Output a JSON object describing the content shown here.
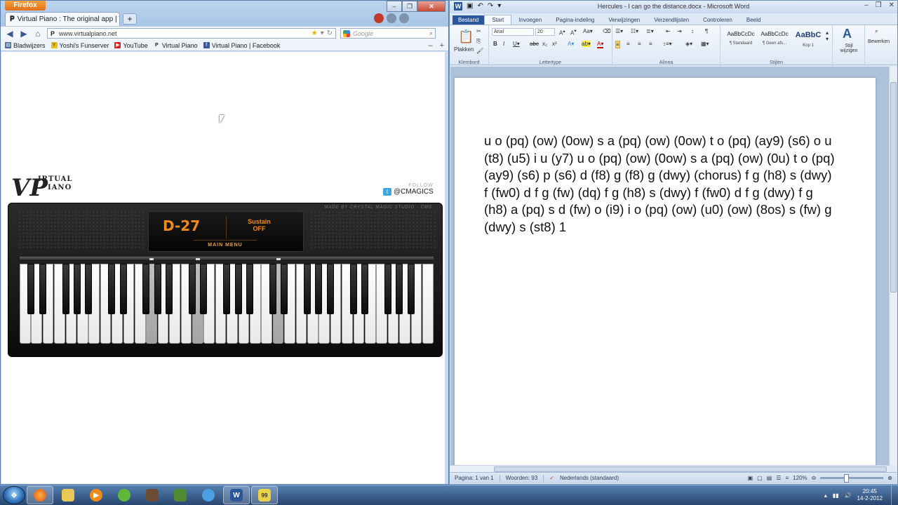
{
  "firefox": {
    "menu_label": "Firefox",
    "tab_title": "Virtual Piano : The original app | Virtual ...",
    "url": "www.virtualpiano.net",
    "search_placeholder": "Google",
    "bookmarks": [
      {
        "label": "Bladwijzers",
        "icon": "bookmarks-icon"
      },
      {
        "label": "Yoshi's Funserver",
        "icon": "yfs-icon"
      },
      {
        "label": "YouTube",
        "icon": "youtube-icon"
      },
      {
        "label": "Virtual Piano",
        "icon": "vp-icon"
      },
      {
        "label": "Virtual Piano | Facebook",
        "icon": "facebook-icon"
      }
    ]
  },
  "piano_page": {
    "logo_text": "IRTUAL",
    "logo_text2": "IANO",
    "follow_label": "FOLLOW",
    "twitter_handle": "@CMAGICS",
    "maker": "MADE BY CRYSTAL MAGIC STUDIO - CMS",
    "note_display": "D-27",
    "sustain_label": "Sustain",
    "sustain_state": "OFF",
    "main_menu": "MAIN MENU",
    "pressed_white_keys": [
      11,
      15,
      22
    ]
  },
  "word": {
    "title": "Hercules - I can go the distance.docx - Microsoft Word",
    "tabs": [
      "Bestand",
      "Start",
      "Invoegen",
      "Pagina-indeling",
      "Verwijzingen",
      "Verzendlijsten",
      "Controleren",
      "Beeld"
    ],
    "groups": {
      "clipboard": "Klembord",
      "paste": "Plakken",
      "font": "Lettertype",
      "font_name": "Arial",
      "font_size": "20",
      "paragraph": "Alinea",
      "styles": "Stijlen",
      "style_samples": [
        {
          "preview": "AaBbCcDc",
          "name": "¶ Standaard"
        },
        {
          "preview": "AaBbCcDc",
          "name": "¶ Geen afs..."
        },
        {
          "preview": "AaBbC",
          "name": "Kop 1"
        }
      ],
      "change_styles": "Stijl wijzigen",
      "editing": "Bewerken"
    },
    "document_text": "u o (pq) (ow) (0ow) s a (pq) (ow) (0ow) t o (pq) (ay9) (s6) o u (t8) (u5) i u (y7) u o (pq) (ow) (0ow) s a (pq) (ow) (0u) t o (pq) (ay9) (s6) p (s6) d (f8) g (f8) g (dwy) (chorus) f g (h8) s (dwy) f (fw0) d f g (fw) (dq) f g (h8) s (dwy) f (fw0) d f g (dwy) f g (h8) a (pq) s d (fw) o (i9) i o (pq) (ow) (u0) (ow) (8os) s (fw) g (dwy) s (st8) 1",
    "status": {
      "page": "Pagina: 1 van 1",
      "words": "Woorden: 93",
      "language": "Nederlands (standaard)",
      "zoom": "120%"
    }
  },
  "taskbar": {
    "time": "20:45",
    "date": "14-2-2012",
    "apps": [
      "firefox-icon",
      "explorer-icon",
      "media-player-icon",
      "xbox-icon",
      "game-icon",
      "minecraft-icon",
      "messenger-icon",
      "word-icon",
      "fraps-icon"
    ]
  }
}
